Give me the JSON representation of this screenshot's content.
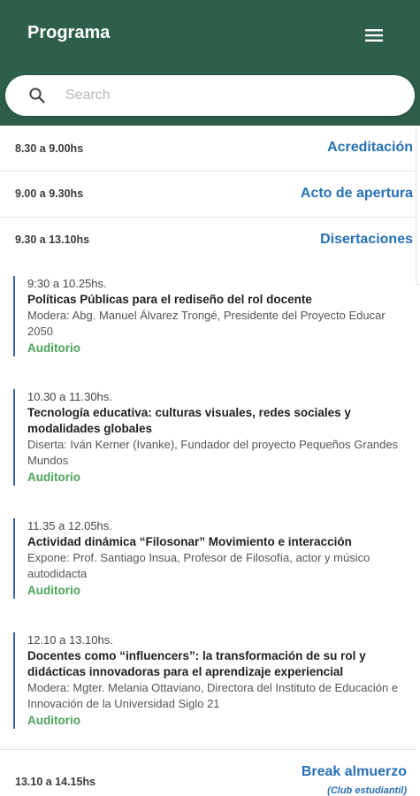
{
  "header": {
    "title": "Programa",
    "menu_icon": "hamburger-menu-icon",
    "background_color": "#2d5f4b"
  },
  "search": {
    "placeholder": "Search",
    "value": ""
  },
  "colors": {
    "link_blue": "#2770b6",
    "location_green": "#4aa459",
    "timeline_blue": "#3d63a8"
  },
  "agenda": [
    {
      "time": "8.30 a 9.00hs",
      "title": "Acreditación"
    },
    {
      "time": "9.00 a 9.30hs",
      "title": "Acto de apertura"
    },
    {
      "time": "9.30 a 13.10hs",
      "title": "Disertaciones"
    }
  ],
  "sessions": [
    {
      "time": "9:30 a 10.25hs.",
      "title": "Políticas Públicas para el rediseño del rol docente",
      "desc": "Modera: Abg. Manuel Álvarez Trongé, Presidente del Proyecto Educar 2050",
      "place": "Auditorio"
    },
    {
      "time": "10.30 a 11.30hs.",
      "title": "Tecnología educativa: culturas visuales, redes sociales y modalidades globales",
      "desc": "Diserta: Iván Kerner (Ivanke), Fundador del proyecto Pequeños Grandes Mundos",
      "place": "Auditorio"
    },
    {
      "time": "11.35 a 12.05hs.",
      "title": "Actividad dinámica “Filosonar” Movimiento e interacción",
      "desc": "Expone: Prof. Santiago Insua, Profesor de Filosofía, actor y músico autodidacta",
      "place": "Auditorio"
    },
    {
      "time": "12.10 a 13.10hs.",
      "title": "Docentes como “influencers”: la transformación de su rol y didácticas innovadoras para el aprendizaje experiencial",
      "desc": "Modera: Mgter. Melania Ottaviano, Directora del Instituto de Educación e Innovación de la Universidad Siglo 21",
      "place": "Auditorio"
    }
  ],
  "break": {
    "time": "13.10 a 14.15hs",
    "title": "Break almuerzo",
    "subtitle": "(Club estudiantil)"
  }
}
